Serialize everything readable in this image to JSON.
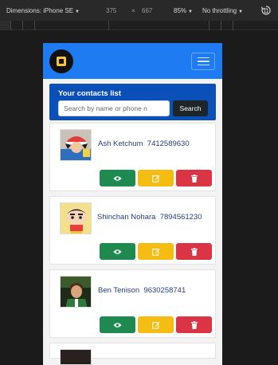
{
  "devtools": {
    "device_label": "Dimensions: iPhone SE",
    "width": "375",
    "times": "×",
    "height": "667",
    "zoom": "85%",
    "throttle": "No throttling"
  },
  "app": {
    "search_title": "Your contacts list",
    "search_placeholder": "Search by name or phone n",
    "search_button": "Search"
  },
  "contacts": [
    {
      "name": "Ash Ketchum",
      "phone": "7412589630"
    },
    {
      "name": "Shinchan Nohara",
      "phone": "7894561230"
    },
    {
      "name": "Ben Tenison",
      "phone": "9630258741"
    }
  ],
  "colors": {
    "navbar": "#1f7bf2",
    "search_panel": "#0b4fb8",
    "view": "#1f8a50",
    "edit": "#f5bd12",
    "delete": "#db3545"
  },
  "icons": {
    "view": "eye-icon",
    "edit": "edit-icon",
    "delete": "trash-icon",
    "menu": "hamburger-icon",
    "rotate": "rotate-icon"
  }
}
